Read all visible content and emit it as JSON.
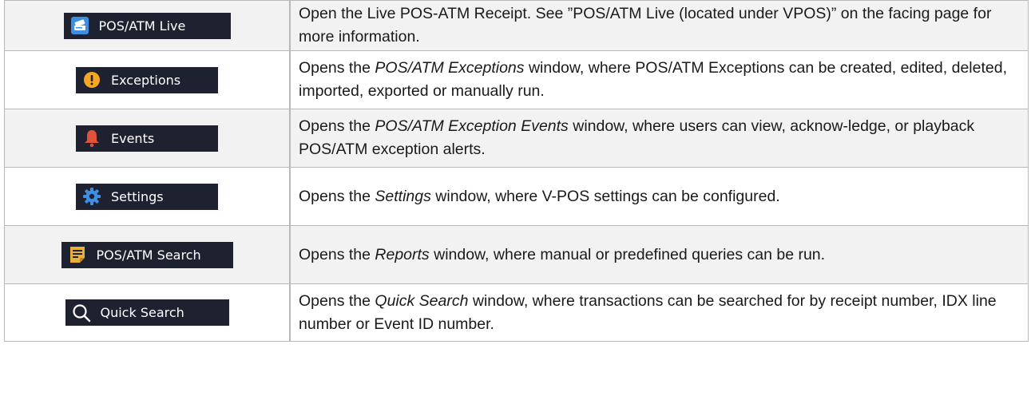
{
  "rows": [
    {
      "button_label": "POS/ATM Live",
      "icon": "receipt-card-icon",
      "desc_before": "Open the Live POS-ATM Receipt. See ”POS/ATM Live (located under VPOS)” on the facing page for more information.",
      "desc_em": "",
      "desc_after": ""
    },
    {
      "button_label": "Exceptions",
      "icon": "exclamation-circle-icon",
      "desc_before": "Opens the ",
      "desc_em": "POS/ATM Exceptions",
      "desc_after": " window, where POS/ATM Exceptions can be created, edited, deleted, imported, exported or manually run."
    },
    {
      "button_label": "Events",
      "icon": "bell-icon",
      "desc_before": "Opens the ",
      "desc_em": "POS/ATM Exception Events",
      "desc_after": " window, where users can view, acknow-ledge, or playback POS/ATM exception alerts."
    },
    {
      "button_label": "Settings",
      "icon": "gear-icon",
      "desc_before": "Opens the ",
      "desc_em": "Settings",
      "desc_after": " window, where V-POS settings can be configured."
    },
    {
      "button_label": "POS/ATM Search",
      "icon": "note-icon",
      "desc_before": "Opens the ",
      "desc_em": "Reports",
      "desc_after": " window, where manual or predefined queries can be run."
    },
    {
      "button_label": "Quick Search",
      "icon": "magnifier-icon",
      "desc_before": "Opens the ",
      "desc_em": "Quick Search",
      "desc_after": " window, where transactions can be searched for by receipt number, IDX line number or Event ID number."
    }
  ],
  "colors": {
    "button_bg": "#1e2230",
    "shade_row": "#f2f2f2",
    "border": "#b9b9b9",
    "blue_icon": "#3f8fe0",
    "orange_icon": "#f5a623",
    "red_icon": "#e2523a",
    "gold_icon": "#e8b036"
  }
}
